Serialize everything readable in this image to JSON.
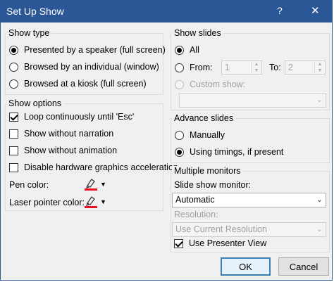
{
  "dialog": {
    "title": "Set Up Show",
    "help": "?",
    "close": "✕"
  },
  "show_type": {
    "legend": "Show type",
    "options": [
      {
        "label": "Presented by a speaker (full screen)",
        "selected": true
      },
      {
        "label": "Browsed by an individual (window)",
        "selected": false
      },
      {
        "label": "Browsed at a kiosk (full screen)",
        "selected": false
      }
    ]
  },
  "show_options": {
    "legend": "Show options",
    "checks": [
      {
        "label": "Loop continuously until 'Esc'",
        "checked": true
      },
      {
        "label": "Show without narration",
        "checked": false
      },
      {
        "label": "Show without animation",
        "checked": false
      },
      {
        "label": "Disable hardware graphics acceleration",
        "checked": false
      }
    ],
    "pen_color_label": "Pen color:",
    "laser_color_label": "Laser pointer color:",
    "pen_color": "#e81123",
    "laser_color": "#e81123"
  },
  "show_slides": {
    "legend": "Show slides",
    "all_label": "All",
    "from_label": "From:",
    "from_value": "1",
    "to_label": "To:",
    "to_value": "2",
    "custom_label": "Custom show:",
    "custom_value": ""
  },
  "advance_slides": {
    "legend": "Advance slides",
    "manually_label": "Manually",
    "timings_label": "Using timings, if present"
  },
  "multiple_monitors": {
    "legend": "Multiple monitors",
    "monitor_label": "Slide show monitor:",
    "monitor_value": "Automatic",
    "resolution_label": "Resolution:",
    "resolution_value": "Use Current Resolution",
    "presenter_view_label": "Use Presenter View",
    "presenter_view_checked": true
  },
  "buttons": {
    "ok": "OK",
    "cancel": "Cancel"
  },
  "colors": {
    "title_bar": "#2b5797",
    "accent": "#3c7fb1"
  }
}
